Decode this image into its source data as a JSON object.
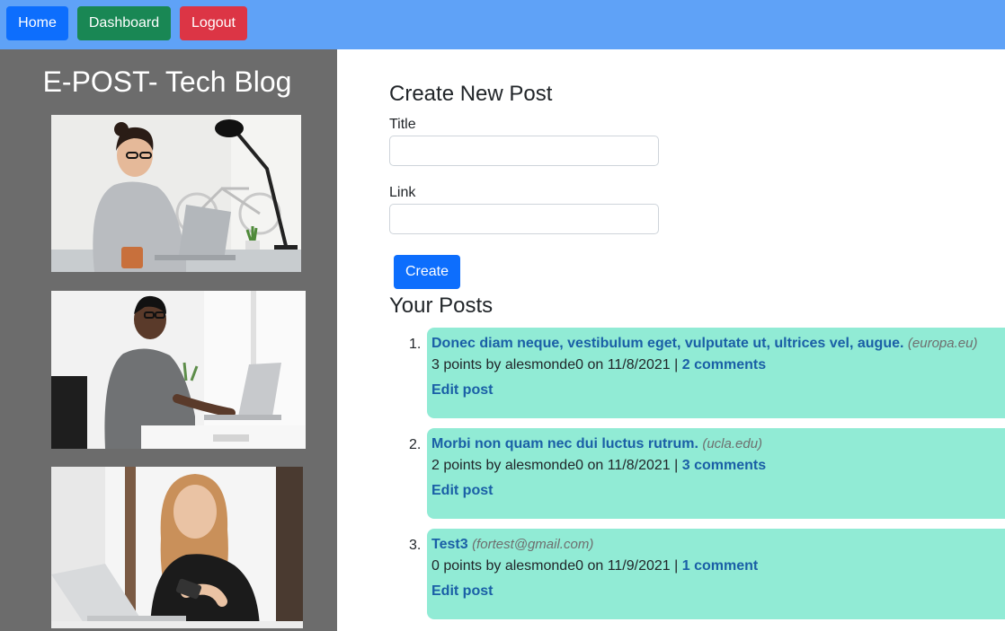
{
  "nav": {
    "home_label": "Home",
    "dashboard_label": "Dashboard",
    "logout_label": "Logout"
  },
  "sidebar": {
    "brand": "E-POST- Tech Blog"
  },
  "create_form": {
    "heading": "Create New Post",
    "title_label": "Title",
    "title_value": "",
    "link_label": "Link",
    "link_value": "",
    "create_label": "Create"
  },
  "posts_section": {
    "heading": "Your Posts",
    "posts": [
      {
        "number": "1.",
        "title": "Donec diam neque, vestibulum eget, vulputate ut, ultrices vel, augue.",
        "domain": "(europa.eu)",
        "meta": "3 points by alesmonde0 on 11/8/2021 |",
        "comments": "2 comments",
        "edit": "Edit post"
      },
      {
        "number": "2.",
        "title": "Morbi non quam nec dui luctus rutrum.",
        "domain": "(ucla.edu)",
        "meta": "2 points by alesmonde0 on 11/8/2021 |",
        "comments": "3 comments",
        "edit": "Edit post"
      },
      {
        "number": "3.",
        "title": "Test3",
        "domain": "(fortest@gmail.com)",
        "meta": "0 points by alesmonde0 on 11/9/2021 |",
        "comments": "1 comment",
        "edit": "Edit post"
      }
    ]
  },
  "colors": {
    "navbar": "#5fa2f7",
    "sidebar": "#6c6c6c",
    "primary": "#0d6efd",
    "success": "#198754",
    "danger": "#dc3545",
    "post_card": "#91ebd5",
    "link": "#1a5fa6"
  }
}
